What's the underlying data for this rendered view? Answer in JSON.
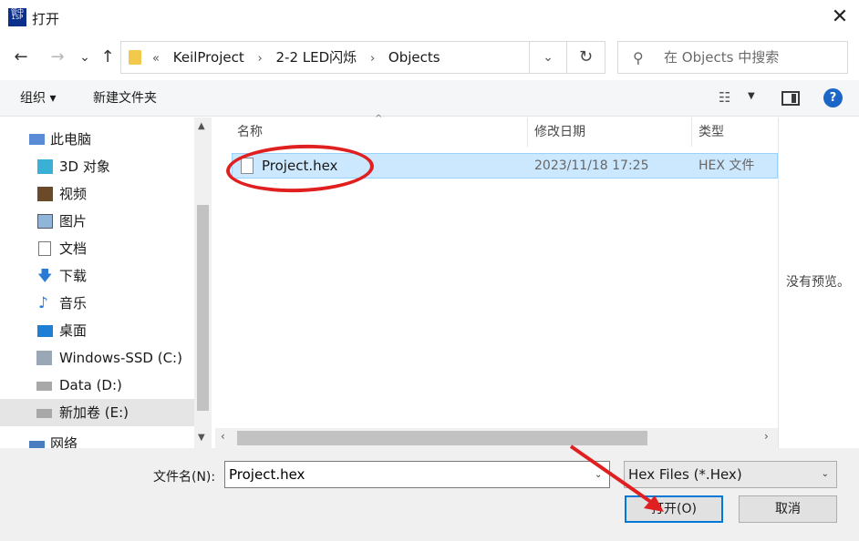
{
  "window": {
    "title": "打开",
    "app_icon_text": [
      "管中",
      "ISP"
    ],
    "close_glyph": "✕"
  },
  "nav": {
    "back": "←",
    "forward": "→",
    "recent": "⌄",
    "up": "↑",
    "breadcrumb_prefix": "«",
    "breadcrumbs": [
      "KeilProject",
      "2-2 LED闪烁",
      "Objects"
    ],
    "search_placeholder": "在 Objects 中搜索"
  },
  "toolbar": {
    "organize": "组织 ▾",
    "new_folder": "新建文件夹",
    "help": "?"
  },
  "sidebar": {
    "items": [
      {
        "label": "此电脑",
        "icon": "computer-icon"
      },
      {
        "label": "3D 对象",
        "icon": "cube-icon"
      },
      {
        "label": "视频",
        "icon": "video-icon"
      },
      {
        "label": "图片",
        "icon": "picture-icon"
      },
      {
        "label": "文档",
        "icon": "document-icon"
      },
      {
        "label": "下载",
        "icon": "download-icon"
      },
      {
        "label": "音乐",
        "icon": "music-icon"
      },
      {
        "label": "桌面",
        "icon": "desktop-icon"
      },
      {
        "label": "Windows-SSD (C:)",
        "icon": "windows-drive-icon"
      },
      {
        "label": "Data (D:)",
        "icon": "drive-icon"
      },
      {
        "label": "新加卷 (E:)",
        "icon": "drive-icon"
      },
      {
        "label": "网络",
        "icon": "network-icon"
      }
    ],
    "selected_index": 10
  },
  "files": {
    "columns": [
      "名称",
      "修改日期",
      "类型"
    ],
    "rows": [
      {
        "name": "Project.hex",
        "date": "2023/11/18 17:25",
        "type": "HEX 文件"
      }
    ]
  },
  "preview": {
    "empty_text": "没有预览。"
  },
  "footer": {
    "filename_label": "文件名(N):",
    "filename_value": "Project.hex",
    "filetype_value": "Hex Files (*.Hex)",
    "open_label": "打开(O)",
    "cancel_label": "取消"
  },
  "colors": {
    "selection": "#cce8ff",
    "annotation_red": "#e02020",
    "accent": "#0078d7"
  }
}
